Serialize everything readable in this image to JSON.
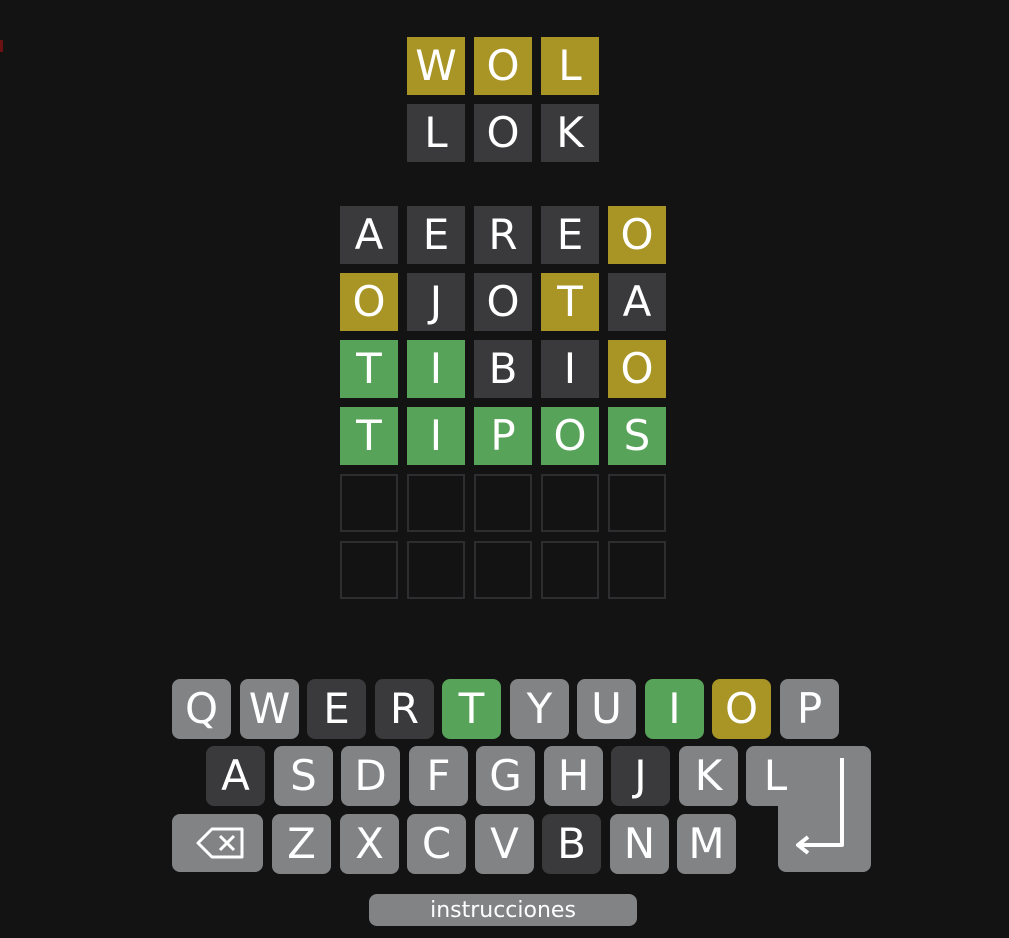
{
  "colors": {
    "background": "#131313",
    "absent": "#3a3a3c",
    "present": "#a89525",
    "correct": "#58a35a",
    "unused": "#818384",
    "empty_border": "#2e2e30"
  },
  "board_top": {
    "rows": [
      [
        {
          "letter": "W",
          "state": "yellow"
        },
        {
          "letter": "O",
          "state": "yellow"
        },
        {
          "letter": "L",
          "state": "yellow"
        }
      ],
      [
        {
          "letter": "L",
          "state": "gray"
        },
        {
          "letter": "O",
          "state": "gray"
        },
        {
          "letter": "K",
          "state": "gray"
        }
      ]
    ]
  },
  "board_main": {
    "rows": [
      [
        {
          "letter": "A",
          "state": "gray"
        },
        {
          "letter": "E",
          "state": "gray"
        },
        {
          "letter": "R",
          "state": "gray"
        },
        {
          "letter": "E",
          "state": "gray"
        },
        {
          "letter": "O",
          "state": "yellow"
        }
      ],
      [
        {
          "letter": "O",
          "state": "yellow"
        },
        {
          "letter": "J",
          "state": "gray"
        },
        {
          "letter": "O",
          "state": "gray"
        },
        {
          "letter": "T",
          "state": "yellow"
        },
        {
          "letter": "A",
          "state": "gray"
        }
      ],
      [
        {
          "letter": "T",
          "state": "green"
        },
        {
          "letter": "I",
          "state": "green"
        },
        {
          "letter": "B",
          "state": "gray"
        },
        {
          "letter": "I",
          "state": "gray"
        },
        {
          "letter": "O",
          "state": "yellow"
        }
      ],
      [
        {
          "letter": "T",
          "state": "green"
        },
        {
          "letter": "I",
          "state": "green"
        },
        {
          "letter": "P",
          "state": "green"
        },
        {
          "letter": "O",
          "state": "green"
        },
        {
          "letter": "S",
          "state": "green"
        }
      ],
      [
        {
          "letter": "",
          "state": "empty"
        },
        {
          "letter": "",
          "state": "empty"
        },
        {
          "letter": "",
          "state": "empty"
        },
        {
          "letter": "",
          "state": "empty"
        },
        {
          "letter": "",
          "state": "empty"
        }
      ],
      [
        {
          "letter": "",
          "state": "empty"
        },
        {
          "letter": "",
          "state": "empty"
        },
        {
          "letter": "",
          "state": "empty"
        },
        {
          "letter": "",
          "state": "empty"
        },
        {
          "letter": "",
          "state": "empty"
        }
      ]
    ]
  },
  "keyboard": {
    "row1": [
      {
        "key": "Q",
        "state": "unused"
      },
      {
        "key": "W",
        "state": "unused"
      },
      {
        "key": "E",
        "state": "absent"
      },
      {
        "key": "R",
        "state": "absent"
      },
      {
        "key": "T",
        "state": "correct"
      },
      {
        "key": "Y",
        "state": "unused"
      },
      {
        "key": "U",
        "state": "unused"
      },
      {
        "key": "I",
        "state": "correct"
      },
      {
        "key": "O",
        "state": "present"
      },
      {
        "key": "P",
        "state": "unused"
      }
    ],
    "row2": [
      {
        "key": "A",
        "state": "absent"
      },
      {
        "key": "S",
        "state": "unused"
      },
      {
        "key": "D",
        "state": "unused"
      },
      {
        "key": "F",
        "state": "unused"
      },
      {
        "key": "G",
        "state": "unused"
      },
      {
        "key": "H",
        "state": "unused"
      },
      {
        "key": "J",
        "state": "absent"
      },
      {
        "key": "K",
        "state": "unused"
      },
      {
        "key": "L",
        "state": "unused"
      }
    ],
    "row3": [
      {
        "key": "Z",
        "state": "unused"
      },
      {
        "key": "X",
        "state": "unused"
      },
      {
        "key": "C",
        "state": "unused"
      },
      {
        "key": "V",
        "state": "unused"
      },
      {
        "key": "B",
        "state": "absent"
      },
      {
        "key": "N",
        "state": "unused"
      },
      {
        "key": "M",
        "state": "unused"
      }
    ],
    "backspace_icon": "backspace-icon",
    "enter_icon": "enter-arrow-icon"
  },
  "instructions_label": "instrucciones"
}
